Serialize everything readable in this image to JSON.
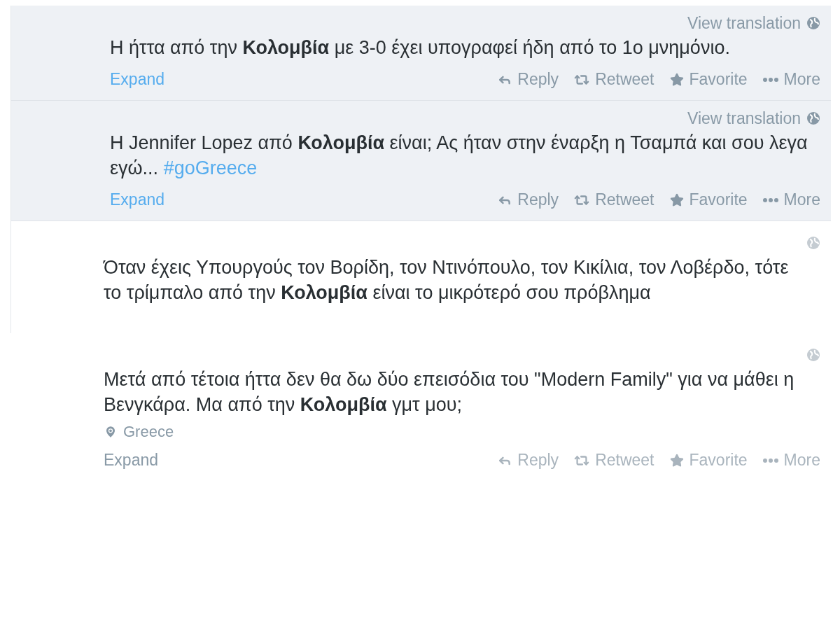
{
  "tweets": [
    {
      "highlighted": true,
      "translation": "View translation",
      "text": "Η ήττα από την **Κολομβία** με 3-0 έχει υπογραφεί ήδη από το 1ο μνημόνιο.",
      "expand": "Expand",
      "actions": [
        "Reply",
        "Retweet",
        "Favorite",
        "More"
      ],
      "actions_faded": false
    },
    {
      "highlighted": true,
      "translation": "View translation",
      "text": "Η Jennifer Lopez από **Κολομβία** είναι; Ας ήταν στην έναρξη η Τσαμπά και σου λεγα εγώ...",
      "hashtag": "#goGreece",
      "expand": "Expand",
      "actions": [
        "Reply",
        "Retweet",
        "Favorite",
        "More"
      ],
      "actions_faded": false
    },
    {
      "highlighted": false,
      "text": "Όταν έχεις Υπουργούς τον Βορίδη, τον Ντινόπουλο, τον Κικίλια, τον Λοβέρδο, τότε το τρίμπαλο από την **Κολομβία** είναι το μικρότερό σου πρόβλημα"
    },
    {
      "highlighted": false,
      "text": "Μετά από τέτοια ήττα δεν θα δω δύο επεισόδια του \"Modern Family\" για να μάθει η Βενγκάρα. Μα από την **Κολομβία** γμτ μου;",
      "location": "Greece",
      "expand": "Expand",
      "actions": [
        "Reply",
        "Retweet",
        "Favorite",
        "More"
      ],
      "actions_faded": true
    }
  ]
}
